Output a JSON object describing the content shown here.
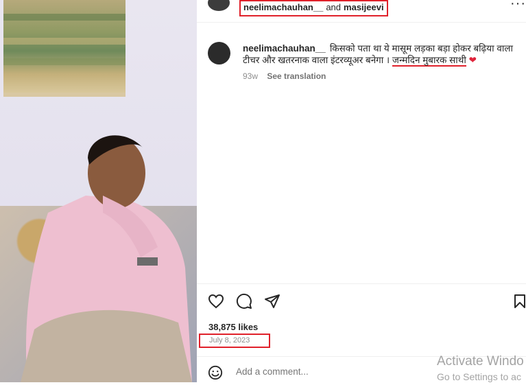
{
  "post": {
    "header": {
      "user1": "neelimachauhan__",
      "and": "and",
      "user2": "masijeevi",
      "more_icon": "more-horizontal-icon"
    },
    "caption": {
      "username": "neelimachauhan__",
      "text": "किसको पता था ये मासूम लड़का बड़ा होकर बढ़िया वाला टीचर और खतरनाक वाला इंटरव्यूअर बनेगा ।",
      "highlight": "जन्मदिन मुबारक साथी",
      "emoji": "❤"
    },
    "meta": {
      "age": "93w",
      "see_translation": "See translation"
    },
    "actions": {
      "like_icon": "heart-icon",
      "comment_icon": "comment-icon",
      "share_icon": "send-icon",
      "save_icon": "bookmark-icon"
    },
    "likes": "38,875 likes",
    "date": "July 8, 2023",
    "add_comment": {
      "placeholder": "Add a comment...",
      "emoji_icon": "emoji-icon"
    }
  },
  "watermark": {
    "line1": "Activate Windo",
    "line2": "Go to Settings to ac"
  },
  "colors": {
    "annotation_red": "#e0202a",
    "heart_red": "#e0243b"
  }
}
